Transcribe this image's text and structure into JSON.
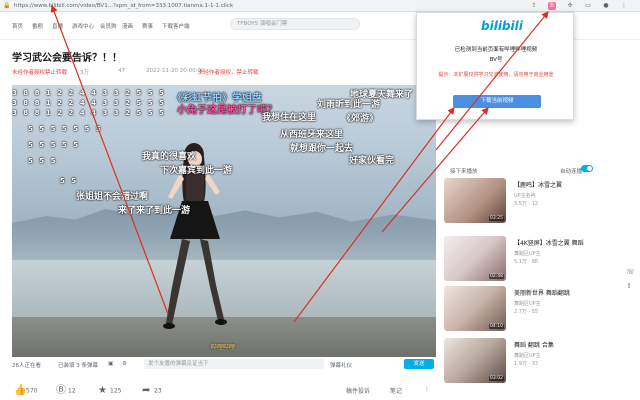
{
  "browser": {
    "url": "https://www.bilibili.com/video/BV1...?spm_id_from=333.1007.tianma.1-1-1.click"
  },
  "header": {
    "nav": [
      "首页",
      "番剧",
      "直播",
      "游戏中心",
      "会员购",
      "漫画",
      "赛事",
      "下载客户端"
    ],
    "search_placeholder": "TFBOYS 演唱会门票"
  },
  "video": {
    "title": "学习武公会要告诉？！！",
    "meta": {
      "warning": "未经作者授权禁止转载",
      "views": "3万",
      "danmaku_count": "47",
      "date": "2022-11-20 20:00:00",
      "note": "未经作者授权，禁止转载"
    },
    "danmaku": [
      "3 8 8 1 2 2 4 4 3 3 2 5 5 5",
      "《彩虹节拍》学姐盘",
      "小兔子这是被打了吧？",
      "地球夏天舞来了",
      "刘雨昕到此一游",
      "我想住在这里",
      "《郊游》",
      "从西班牙来这里",
      "就想跟你一起去",
      "我真的很喜欢",
      "下次嘉宾到此一游",
      "好家伙看完",
      "张姐姐不会错过啊",
      "来了来了到此一游"
    ],
    "subtitle": "哔哩哔哩",
    "controls": {
      "viewers": "26人正在看",
      "danmaku_loaded": "已装填 3 条弹幕",
      "danmaku_placeholder": "发个友善的弹幕见证当下",
      "etiquette": "弹幕礼仪",
      "send": "发送"
    },
    "actions": {
      "like": "570",
      "coin": "12",
      "favorite": "125",
      "share": "23"
    },
    "report": "稿件投诉",
    "notes": "笔记"
  },
  "sidebar": {
    "header": "接下来播放",
    "autoplay_label": "自动连播",
    "videos": [
      {
        "title": "【鹿鸣】冰雪之翼",
        "meta": "UP主名称",
        "stats": "3.5万 · 12",
        "duration": "03:25"
      },
      {
        "title": "【4K竖屏】冰雪之翼 舞蹈",
        "meta": "舞蹈区UP主",
        "stats": "5.1万 · 86",
        "duration": "02:48"
      },
      {
        "title": "美丽新世界 舞蹈翻跳",
        "meta": "舞蹈区UP主",
        "stats": "2.7万 · 55",
        "duration": "04:10"
      },
      {
        "title": "舞蹈 翻跳 合集",
        "meta": "舞蹈区UP主",
        "stats": "1.9万 · 33",
        "duration": "03:02"
      }
    ]
  },
  "popup": {
    "logo": "bilibili",
    "description": "已检测到当前页面有哔哩哔哩视频",
    "sub": "BV号",
    "warning": "提示：本扩展仅供学习交流使用，请勿用于商业用途",
    "button": "下载当前视频"
  },
  "colors": {
    "accent": "#00aeec",
    "popup_button": "#4a90e2",
    "warning": "#e0473f",
    "arrow": "#d93025"
  }
}
